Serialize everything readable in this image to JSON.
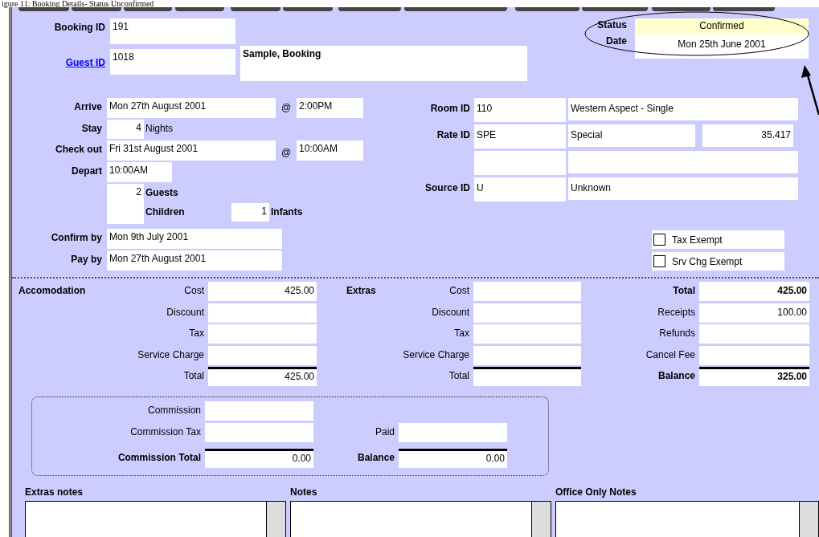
{
  "caption": "igure 11: Booking Details- Status Unconfirmed",
  "booking_id": {
    "label": "Booking ID",
    "value": "191"
  },
  "guest_id": {
    "label": "Guest ID",
    "value": "1018"
  },
  "guest_name": "Sample, Booking",
  "status": {
    "label": "Status",
    "value": "Confirmed"
  },
  "date": {
    "label": "Date",
    "value": "Mon 25th June 2001"
  },
  "arrive": {
    "label": "Arrive",
    "date": "Mon 27th August 2001",
    "at": "@",
    "time": "2:00PM"
  },
  "stay": {
    "label": "Stay",
    "value": "4",
    "unit": "Nights"
  },
  "check_out": {
    "label": "Check out",
    "date": "Fri 31st August 2001",
    "at": "@",
    "time": "10:00AM"
  },
  "depart": {
    "label": "Depart",
    "value": "10:00AM"
  },
  "guests": {
    "value": "2",
    "label": "Guests"
  },
  "children": {
    "label": "Children",
    "value": "1",
    "unit": "Infants"
  },
  "confirm_by": {
    "label": "Confirm by",
    "value": "Mon 9th July 2001"
  },
  "pay_by": {
    "label": "Pay by",
    "value": "Mon 27th August 2001"
  },
  "lookups": [
    {
      "kind": "lookup",
      "label": "Room ID",
      "code": "110",
      "description": "Western Aspect - Single"
    },
    {
      "kind": "rate",
      "label": "Rate ID",
      "code": "SPE",
      "description": "Special",
      "amount": "35.417"
    },
    {
      "kind": "blank"
    },
    {
      "kind": "lookup",
      "label": "Source ID",
      "code": "U",
      "description": "Unknown"
    }
  ],
  "exemptions": [
    {
      "label": "Tax Exempt",
      "checked": false
    },
    {
      "label": "Srv Chg Exempt",
      "checked": false
    }
  ],
  "accommodation": {
    "title": "Accomodation",
    "rows": [
      {
        "label": "Cost",
        "value": "425.00",
        "sum": false,
        "bold": false
      },
      {
        "label": "Discount",
        "sum": false,
        "bold": false
      },
      {
        "label": "Tax",
        "sum": false,
        "bold": false
      },
      {
        "label": "Service Charge",
        "sum": false,
        "bold": false
      },
      {
        "label": "Total",
        "value": "425.00",
        "sum": true,
        "bold": false
      }
    ]
  },
  "extras": {
    "title": "Extras",
    "rows": [
      {
        "label": "Cost",
        "sum": false,
        "bold": false
      },
      {
        "label": "Discount",
        "sum": false,
        "bold": false
      },
      {
        "label": "Tax",
        "sum": false,
        "bold": false
      },
      {
        "label": "Service Charge",
        "sum": false,
        "bold": false
      },
      {
        "label": "Total",
        "sum": true,
        "bold": false
      }
    ]
  },
  "summary": {
    "rows": [
      {
        "label": "Total",
        "value": "425.00",
        "sum": false,
        "bold": true
      },
      {
        "label": "Receipts",
        "value": "100.00",
        "sum": false,
        "bold": false
      },
      {
        "label": "Refunds",
        "sum": false,
        "bold": false
      },
      {
        "label": "Cancel Fee",
        "sum": false,
        "bold": false
      },
      {
        "label": "Balance",
        "value": "325.00",
        "sum": true,
        "bold": true
      }
    ]
  },
  "commission": {
    "left": [
      {
        "label": "Commission",
        "sum": false,
        "bold": false
      },
      {
        "label": "Commission Tax",
        "sum": false,
        "bold": false
      },
      {
        "label": "Commission Total",
        "value": "0.00",
        "sum": true,
        "bold": true
      }
    ],
    "right": [
      {
        "label": "Paid",
        "sum": false,
        "bold": false
      },
      {
        "label": "Balance",
        "value": "0.00",
        "sum": true,
        "bold": true
      }
    ]
  },
  "notes": [
    {
      "label": "Extras notes"
    },
    {
      "label": "Notes"
    },
    {
      "label": "Office Only Notes"
    }
  ]
}
